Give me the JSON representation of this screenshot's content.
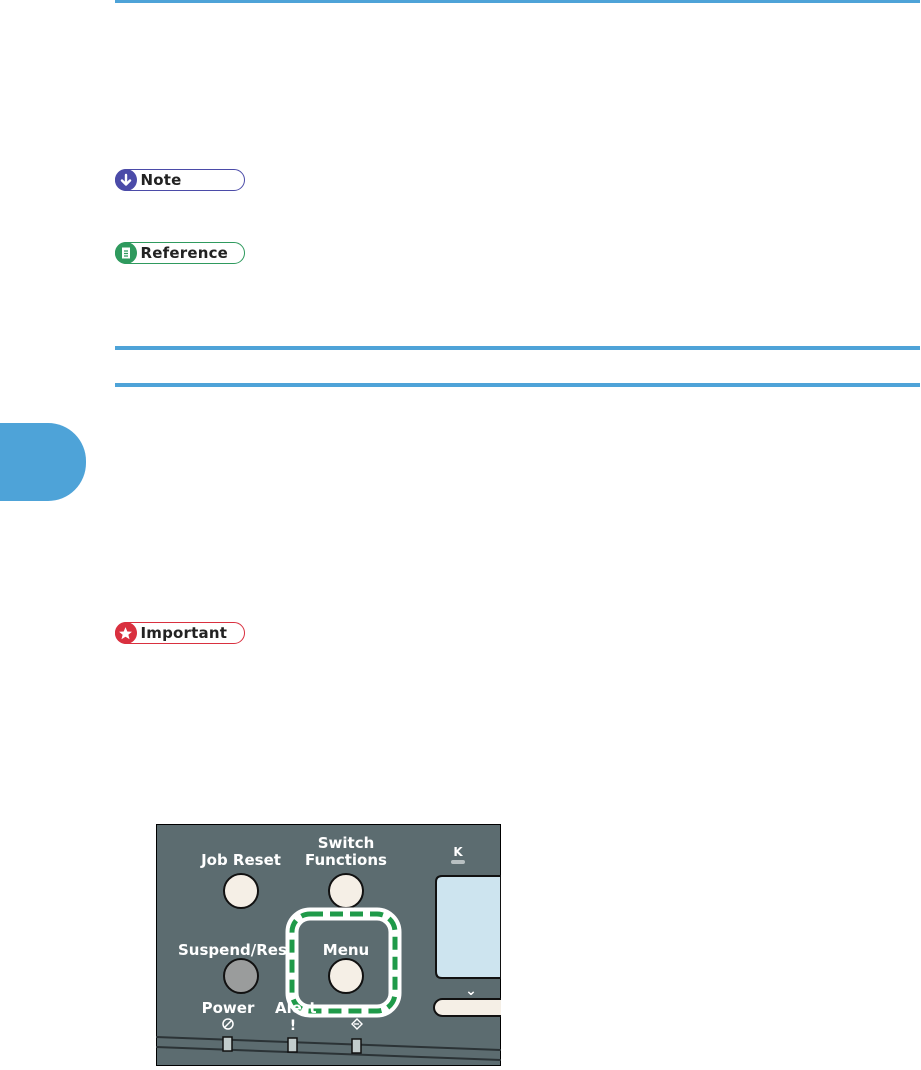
{
  "badges": {
    "note": "Note",
    "reference": "Reference",
    "important": "Important"
  },
  "panel": {
    "job_reset": "Job Reset",
    "switch_line1": "Switch",
    "switch_line2": "Functions",
    "k_label": "K",
    "suspend_resume": "Suspend/Resume",
    "menu": "Menu",
    "power": "Power",
    "alert": "Alert",
    "alert_symbol": "!"
  },
  "colors": {
    "rule_blue": "#4ea3d8",
    "panel_gray": "#5c6c70",
    "highlight_green": "#1f9a49",
    "note_purple": "#4b4ba8",
    "reference_green": "#2f9a5e",
    "important_red": "#d9303f"
  },
  "icons": {
    "note": "arrow-down-icon",
    "reference": "document-icon",
    "important": "star-icon"
  }
}
